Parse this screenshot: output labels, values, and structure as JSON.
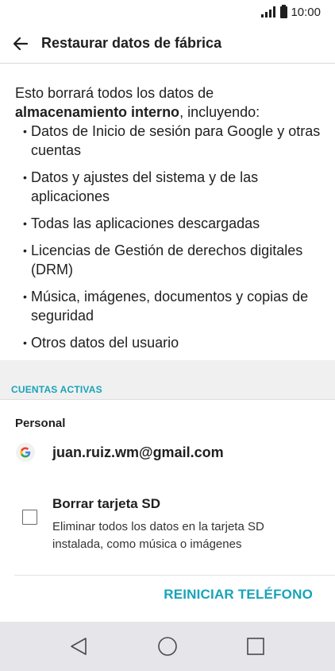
{
  "status_bar": {
    "time": "10:00",
    "icons": [
      "signal-icon",
      "battery-icon"
    ]
  },
  "app_bar": {
    "back_icon": "arrow-left-icon",
    "title": "Restaurar datos de fábrica"
  },
  "intro": {
    "text_before": "Esto borrará todos los datos de ",
    "text_bold": "almacenamiento interno",
    "text_after": ", incluyendo:"
  },
  "bullets": [
    "Datos de Inicio de sesión para Google y otras cuentas",
    "Datos y ajustes del sistema y de las aplicaciones",
    "Todas las aplicaciones descargadas",
    "Licencias de Gestión de derechos digitales (DRM)",
    "Música, imágenes, documentos y copias de seguridad",
    "Otros datos del usuario"
  ],
  "accounts_section": {
    "header": "CUENTAS ACTIVAS",
    "group_label": "Personal",
    "account": {
      "icon": "google-icon",
      "email": "juan.ruiz.wm@gmail.com"
    }
  },
  "sd_option": {
    "title": "Borrar tarjeta SD",
    "description": "Eliminar todos los datos en la tarjeta SD instalada, como música o imágenes",
    "checked": false
  },
  "actions": {
    "reset_label": "REINICIAR TELÉFONO"
  },
  "nav_bar": {
    "icons": [
      "back-triangle-icon",
      "home-circle-icon",
      "recents-square-icon"
    ]
  },
  "colors": {
    "accent": "#19a3b8",
    "section_background": "#f0f0f0",
    "nav_background": "#e6e6ea"
  }
}
